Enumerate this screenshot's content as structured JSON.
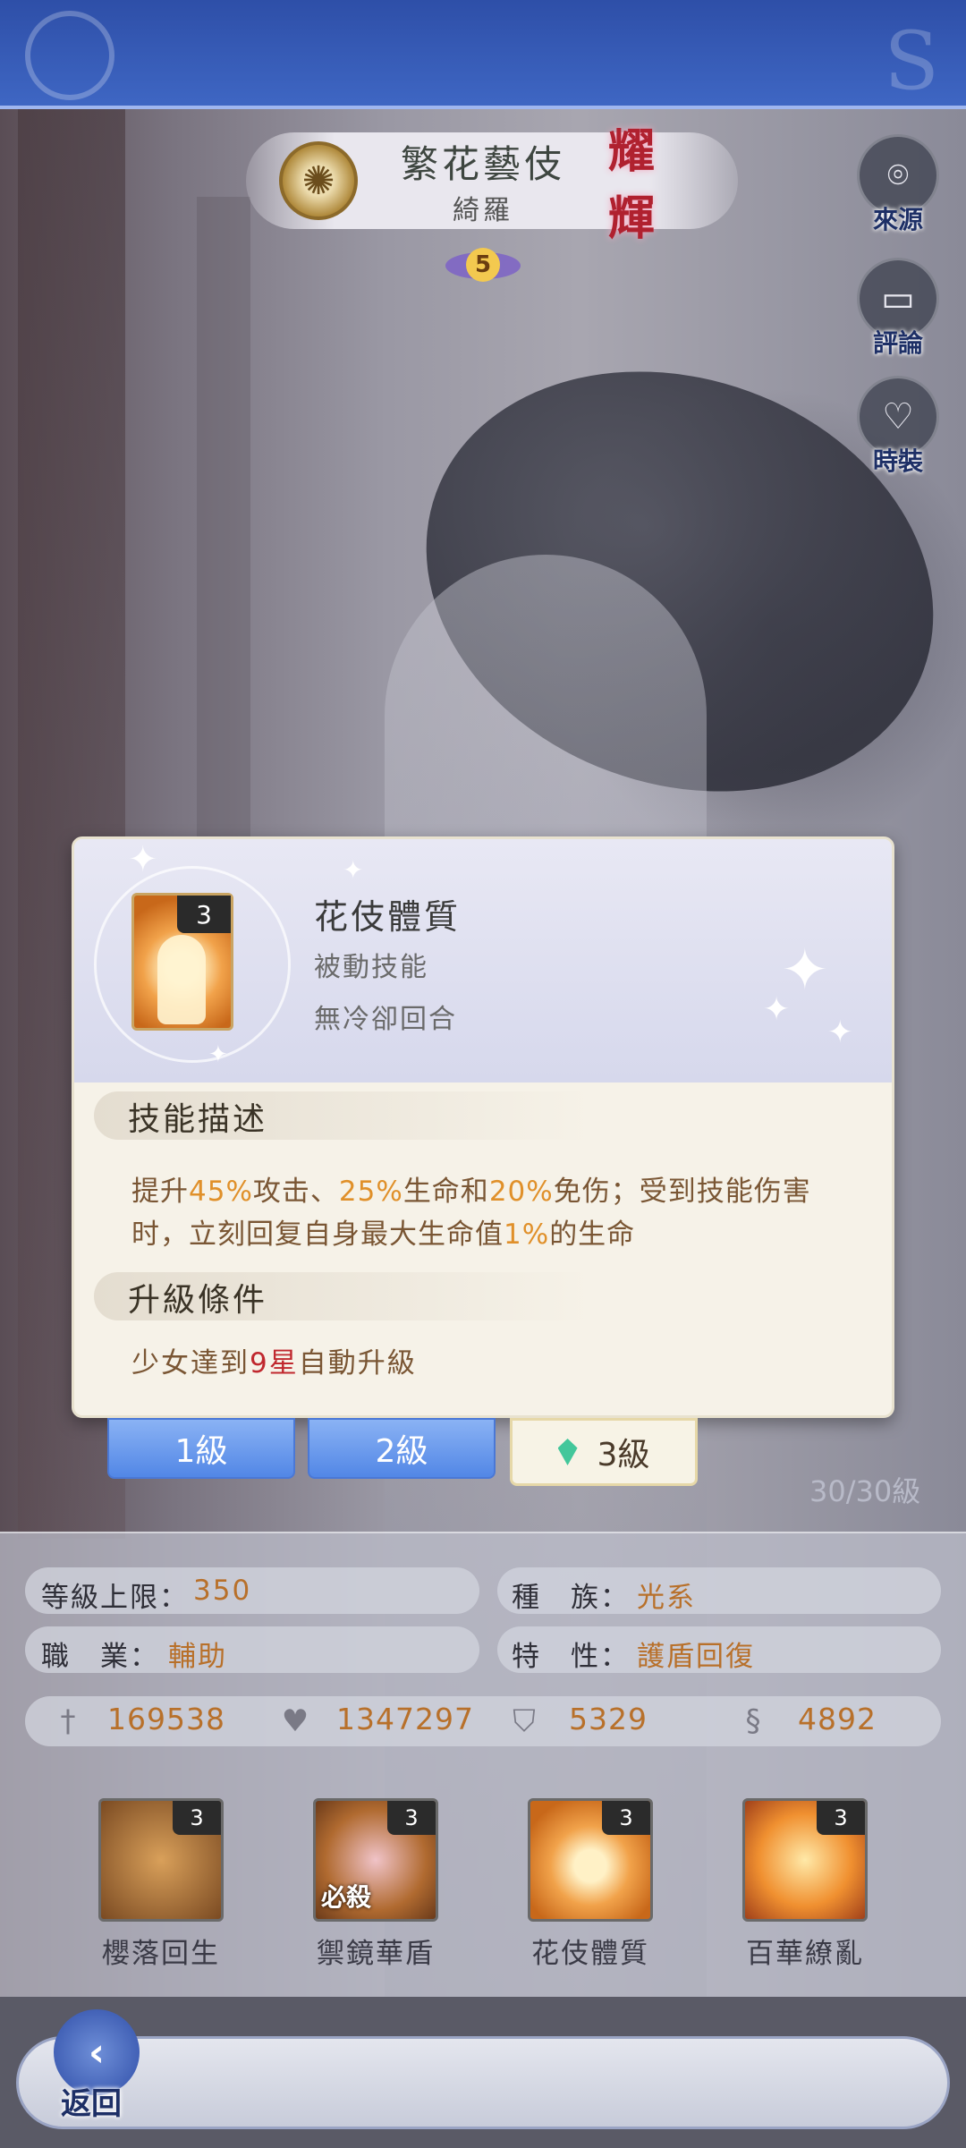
{
  "hero": {
    "name": "繁花藝伎",
    "subname": "綺羅",
    "rank_badge": "耀輝",
    "stars": "5"
  },
  "side_buttons": [
    {
      "label": "來源",
      "icon": "location-pin-icon"
    },
    {
      "label": "評論",
      "icon": "chat-bubble-icon"
    },
    {
      "label": "時裝",
      "icon": "outfit-icon"
    }
  ],
  "skill_popup": {
    "icon_level": "3",
    "title": "花伎體質",
    "type": "被動技能",
    "cooldown": "無冷卻回合",
    "desc_section": "技能描述",
    "desc_parts": {
      "p1": "提升",
      "v1": "45%",
      "p2": "攻击、",
      "v2": "25%",
      "p3": "生命和",
      "v3": "20%",
      "p4": "免伤；受到技能伤害时，立刻回复自身最大生命值",
      "v4": "1%",
      "p5": "的生命"
    },
    "upgrade_section": "升級條件",
    "upgrade_parts": {
      "p1": "少女達到",
      "v1": "9星",
      "p2": "自動升級"
    }
  },
  "level_tabs": [
    "1級",
    "2級",
    "3級"
  ],
  "level_count": "30/30級",
  "stats": {
    "level_cap_label": "等級上限：",
    "level_cap": "350",
    "race_label": "種　族：",
    "race": "光系",
    "job_label": "職　業：",
    "job": "輔助",
    "trait_label": "特　性：",
    "trait": "護盾回復",
    "attack": "169538",
    "hp": "1347297",
    "defense": "5329",
    "speed": "4892"
  },
  "skills": [
    {
      "name": "櫻落回生",
      "level": "3",
      "tag": ""
    },
    {
      "name": "禦鏡華盾",
      "level": "3",
      "tag": "必殺"
    },
    {
      "name": "花伎體質",
      "level": "3",
      "tag": ""
    },
    {
      "name": "百華繚亂",
      "level": "3",
      "tag": ""
    }
  ],
  "back_label": "返回",
  "colors": {
    "top_bar": "#3f67c4",
    "highlight_orange": "#e0902a",
    "highlight_red": "#c0282e",
    "stat_value": "#b8702a",
    "tab_blue": "#5287e6"
  }
}
